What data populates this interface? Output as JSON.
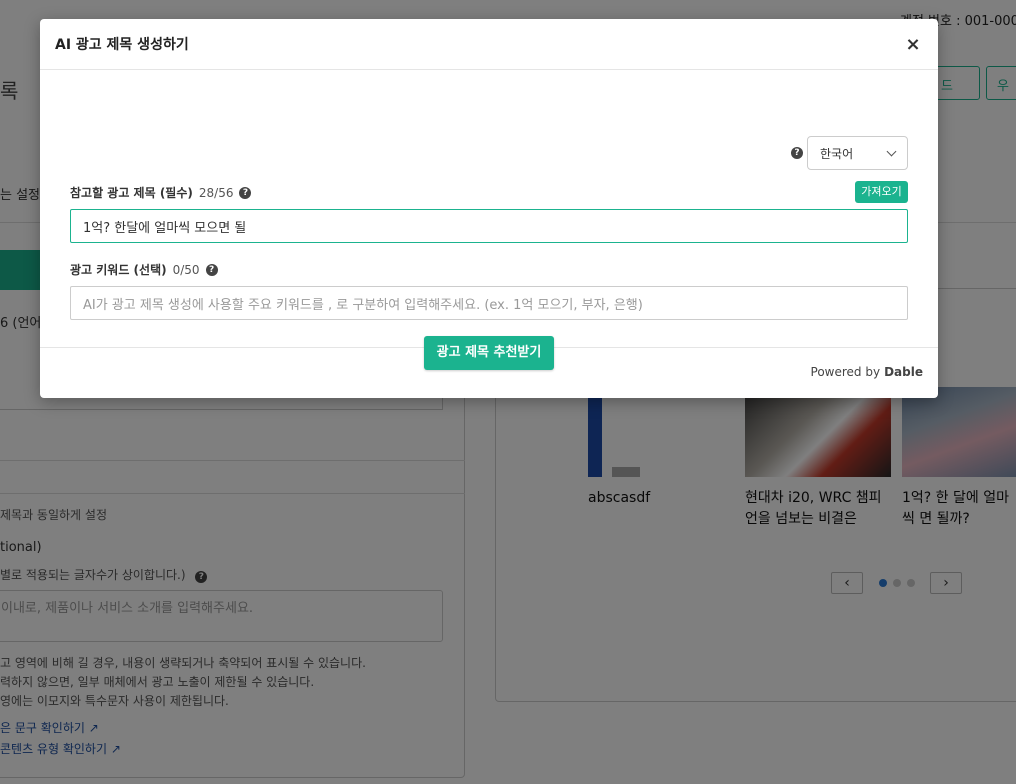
{
  "background": {
    "account_number": "계정 번호 : 001-000",
    "left_title": "록",
    "right_btn1": "드",
    "right_btn2": "우",
    "setting": "는 설정",
    "lang_note": "6 (언어",
    "same_setting": "제목과 동일하게 설정",
    "optional": "tional)",
    "char_note": "별로 적용되는 글자수가 상이합니다.)",
    "desc_placeholder": "이내로, 제품이나 서비스 소개를 입력해주세요.",
    "notes": [
      "고 영역에 비해 길 경우, 내용이 생략되거나 축약되어 표시될 수 있습니다.",
      "력하지 않으면, 일부 매체에서 광고 노출이 제한될 수 있습니다.",
      "영에는 이모지와 특수문자 사용이 제한됩니다."
    ],
    "links": [
      "은 문구 확인하기",
      "콘텐츠 유형 확인하기"
    ],
    "previews": [
      {
        "title": "abscasdf"
      },
      {
        "title": "현대차 i20, WRC 챔피언을 넘보는 비결은"
      },
      {
        "title": "1억? 한 달에 얼마씩 면 될까?"
      }
    ],
    "prev_arrow": "‹",
    "next_arrow": "›"
  },
  "modal": {
    "title": "AI 광고 제목 생성하기",
    "close": "×",
    "language": {
      "help": "?",
      "value": "한국어"
    },
    "ref_title": {
      "label": "참고할 광고 제목 (필수)",
      "count": "28/56",
      "help": "?",
      "fetch_label": "가져오기",
      "value": "1억? 한달에 얼마씩 모으면 될"
    },
    "keywords": {
      "label": "광고 키워드 (선택)",
      "count": "0/50",
      "help": "?",
      "placeholder": "AI가 광고 제목 생성에 사용할 주요 키워드를 , 로 구분하여 입력해주세요. (ex. 1억 모으기, 부자, 은행)"
    },
    "recommend_label": "광고 제목 추천받기",
    "footer": {
      "powered": "Powered by",
      "brand": "Dable"
    }
  }
}
